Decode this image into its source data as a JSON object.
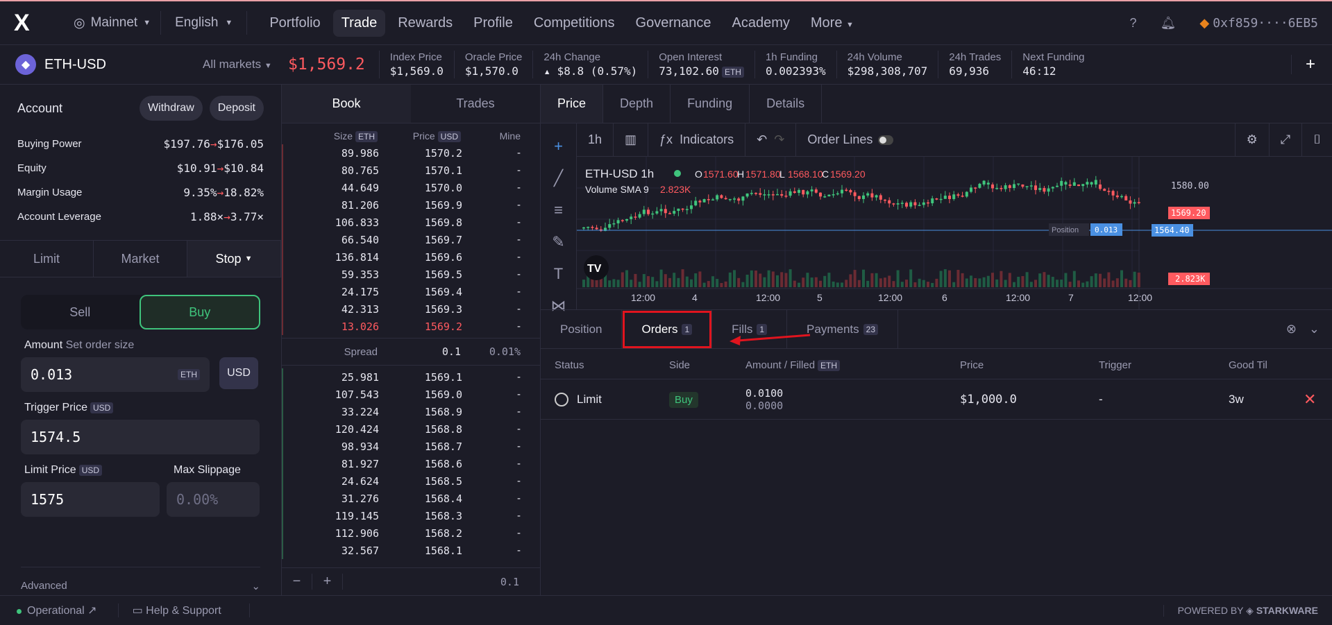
{
  "app": {
    "logo": "X"
  },
  "topbar": {
    "network": "Mainnet",
    "language": "English",
    "nav": [
      "Portfolio",
      "Trade",
      "Rewards",
      "Profile",
      "Competitions",
      "Governance",
      "Academy",
      "More"
    ],
    "wallet": "0xf859····6EB5"
  },
  "market": {
    "pair": "ETH-USD",
    "all_markets": "All markets",
    "price": "$1,569.2",
    "stats": [
      {
        "label": "Index Price",
        "value": "$1,569.0"
      },
      {
        "label": "Oracle Price",
        "value": "$1,570.0"
      },
      {
        "label": "24h Change",
        "value": "▴ $8.8 (0.57%)"
      },
      {
        "label": "Open Interest",
        "value": "73,102.60",
        "unit": "ETH"
      },
      {
        "label": "1h Funding",
        "value": "0.002393%"
      },
      {
        "label": "24h Volume",
        "value": "$298,308,707"
      },
      {
        "label": "24h Trades",
        "value": "69,936"
      },
      {
        "label": "Next Funding",
        "value": "46:12"
      }
    ]
  },
  "account": {
    "title": "Account",
    "withdraw": "Withdraw",
    "deposit": "Deposit",
    "rows": [
      {
        "label": "Buying Power",
        "from": "$197.76",
        "to": "$176.05"
      },
      {
        "label": "Equity",
        "from": "$10.91",
        "to": "$10.84"
      },
      {
        "label": "Margin Usage",
        "from": "9.35%",
        "to": "18.82%"
      },
      {
        "label": "Account Leverage",
        "from": "1.88×",
        "to": "3.77×"
      }
    ]
  },
  "order_form": {
    "tabs": [
      "Limit",
      "Market",
      "Stop"
    ],
    "sell": "Sell",
    "buy": "Buy",
    "amount_label": "Amount",
    "amount_hint": "Set order size",
    "amount_value": "0.013",
    "amount_unit": "ETH",
    "usd_toggle": "USD",
    "trigger_label": "Trigger Price",
    "trigger_unit": "USD",
    "trigger_value": "1574.5",
    "limit_label": "Limit Price",
    "limit_unit": "USD",
    "limit_value": "1575",
    "slippage_label": "Max Slippage",
    "slippage_placeholder": "0.00%",
    "advanced": "Advanced"
  },
  "book": {
    "tabs": [
      "Book",
      "Trades"
    ],
    "headers": {
      "size": "Size",
      "size_unit": "ETH",
      "price": "Price",
      "price_unit": "USD",
      "mine": "Mine"
    },
    "asks": [
      [
        "89.986",
        "1570.2"
      ],
      [
        "80.765",
        "1570.1"
      ],
      [
        "44.649",
        "1570.0"
      ],
      [
        "81.206",
        "1569.9"
      ],
      [
        "106.833",
        "1569.8"
      ],
      [
        "66.540",
        "1569.7"
      ],
      [
        "136.814",
        "1569.6"
      ],
      [
        "59.353",
        "1569.5"
      ],
      [
        "24.175",
        "1569.4"
      ],
      [
        "42.313",
        "1569.3"
      ],
      [
        "13.026",
        "1569.2"
      ]
    ],
    "spread": {
      "label": "Spread",
      "value": "0.1",
      "pct": "0.01%"
    },
    "bids": [
      [
        "25.981",
        "1569.1"
      ],
      [
        "107.543",
        "1569.0"
      ],
      [
        "33.224",
        "1568.9"
      ],
      [
        "120.424",
        "1568.8"
      ],
      [
        "98.934",
        "1568.7"
      ],
      [
        "81.927",
        "1568.6"
      ],
      [
        "24.624",
        "1568.5"
      ],
      [
        "31.276",
        "1568.4"
      ],
      [
        "119.145",
        "1568.3"
      ],
      [
        "112.906",
        "1568.2"
      ],
      [
        "32.567",
        "1568.1"
      ]
    ],
    "mine_dash": "-",
    "footer": {
      "minus": "−",
      "plus": "+",
      "grouping": "0.1"
    }
  },
  "chart": {
    "tabs": [
      "Price",
      "Depth",
      "Funding",
      "Details"
    ],
    "interval": "1h",
    "indicators": "Indicators",
    "order_lines": "Order Lines",
    "symbol": "ETH-USD",
    "ohlc": {
      "o": "1571.60",
      "h": "1571.80",
      "l": "1568.10",
      "c": "1569.20"
    },
    "volume_label": "Volume SMA 9",
    "volume_value": "2.823K",
    "position_label": "Position",
    "position_value": "0.013",
    "price_tags": [
      "1580.00",
      "1569.20",
      "1564.40",
      "2.823K"
    ],
    "x_ticks": [
      "12:00",
      "4",
      "12:00",
      "5",
      "12:00",
      "6",
      "12:00",
      "7",
      "12:00"
    ],
    "colors": {
      "up": "#3fc47c",
      "down": "#ff5a5f",
      "position": "#4a90e2"
    }
  },
  "orders_panel": {
    "tabs": [
      {
        "label": "Position",
        "count": ""
      },
      {
        "label": "Orders",
        "count": "1"
      },
      {
        "label": "Fills",
        "count": "1"
      },
      {
        "label": "Payments",
        "count": "23"
      }
    ],
    "headers": [
      "Status",
      "Side",
      "Amount / Filled",
      "Price",
      "Trigger",
      "Good Til"
    ],
    "amount_unit": "ETH",
    "rows": [
      {
        "status": "Limit",
        "side": "Buy",
        "amount": "0.0100",
        "filled": "0.0000",
        "price": "$1,000.0",
        "trigger": "-",
        "good_til": "3w"
      }
    ]
  },
  "status": {
    "operational": "Operational",
    "help": "Help & Support",
    "powered": "POWERED BY",
    "brand": "STARKWARE"
  }
}
